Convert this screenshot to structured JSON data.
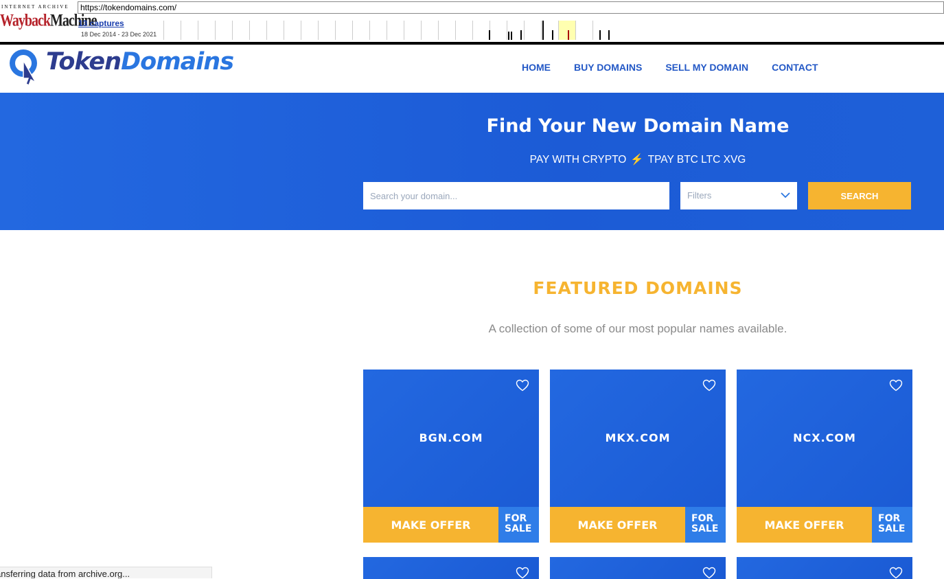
{
  "wayback": {
    "logo_top": "INTERNET ARCHIVE",
    "logo_wayback": "Wayback",
    "logo_machine": "Machine",
    "url": "https://tokendomains.com/",
    "captures": "13 captures",
    "range": "18 Dec 2014 - 23 Dec 2021"
  },
  "header": {
    "brand_part1": "Token",
    "brand_part2": "Domains",
    "nav": [
      "HOME",
      "BUY DOMAINS",
      "SELL MY DOMAIN",
      "CONTACT"
    ]
  },
  "hero": {
    "title": "Find Your New Domain Name",
    "pay_prefix": "PAY WITH CRYPTO",
    "bolt": "⚡",
    "pay_coins": "TPAY BTC LTC XVG",
    "search_placeholder": "Search your domain...",
    "filters_label": "Filters",
    "search_button": "SEARCH"
  },
  "featured": {
    "title": "FEATURED DOMAINS",
    "subtitle": "A collection of some of our most popular names available.",
    "offer_label": "MAKE OFFER",
    "forsale_line1": "FOR",
    "forsale_line2": "SALE",
    "cards": [
      {
        "domain": "BGN.COM"
      },
      {
        "domain": "MKX.COM"
      },
      {
        "domain": "NCX.COM"
      }
    ]
  },
  "status_bar": "ansferring data from archive.org...",
  "colors": {
    "primary_blue": "#1e60d8",
    "accent_yellow": "#f6b430",
    "nav_blue": "#2358c6"
  },
  "icons": {
    "heart": "heart-icon",
    "filters_chevron": "chevron-down-icon",
    "logo_cursor": "cursor-icon",
    "hero_bolt": "lightning-icon"
  }
}
